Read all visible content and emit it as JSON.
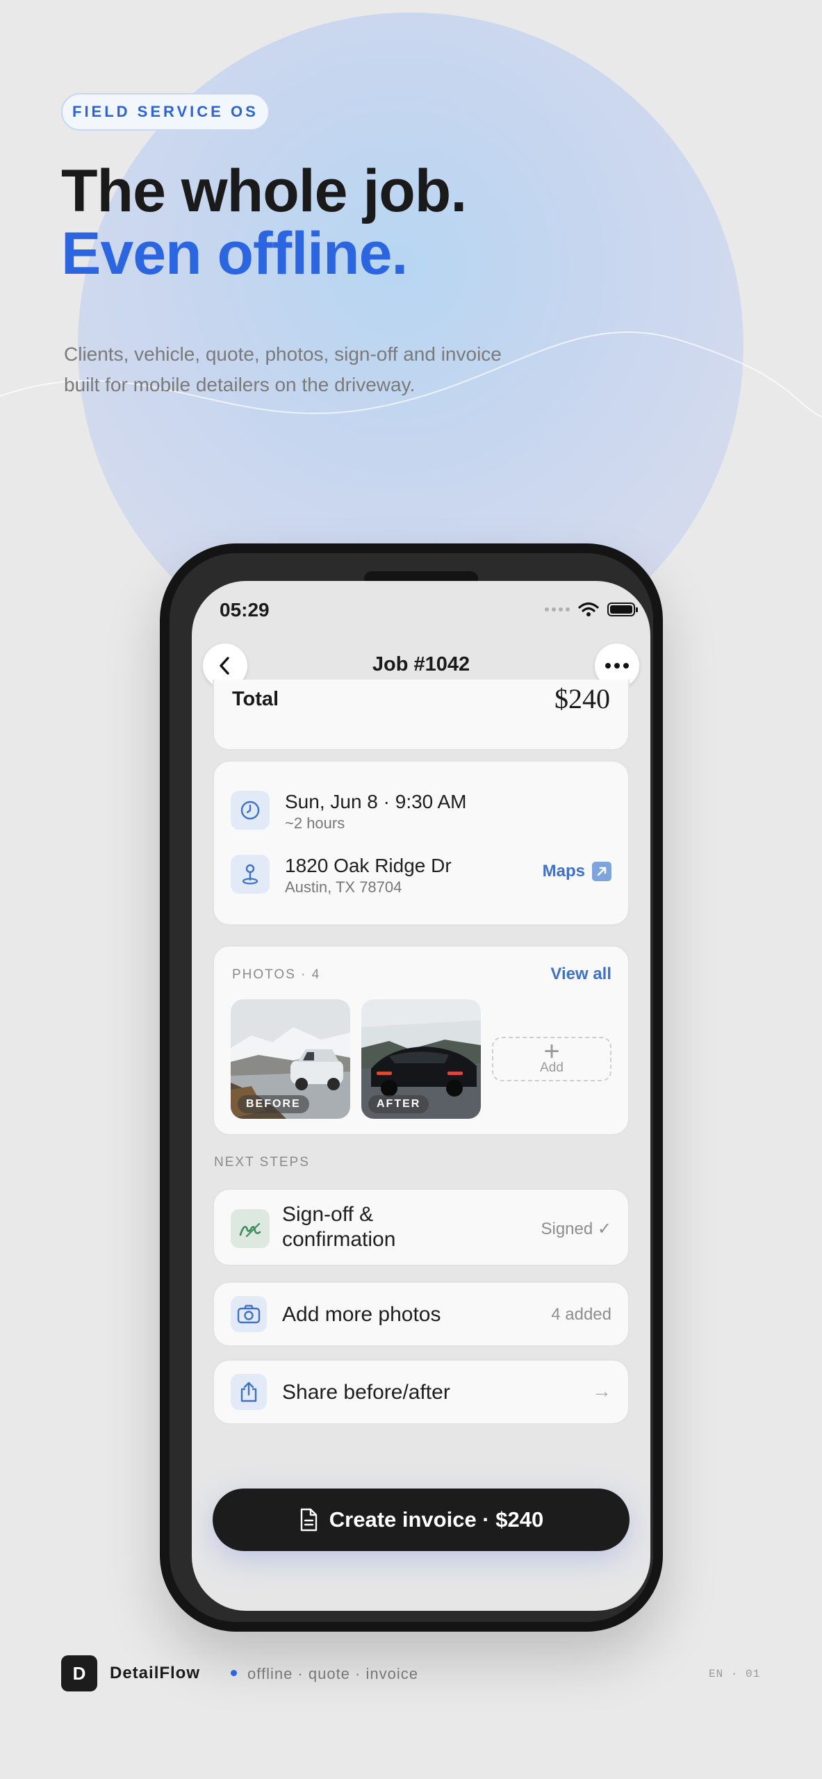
{
  "hero": {
    "badge": "FIELD SERVICE OS",
    "title_line1": "The whole job.",
    "title_line2": "Even offline.",
    "subtitle_line1": "Clients, vehicle, quote, photos, sign-off and invoice",
    "subtitle_line2": "built for mobile detailers on the driveway."
  },
  "status_bar": {
    "time": "05:29"
  },
  "nav": {
    "title": "Job #1042",
    "back_icon": "chevron-left-icon",
    "more_icon": "ellipsis-icon"
  },
  "total": {
    "label": "Total",
    "value": "$240"
  },
  "schedule": {
    "date": "Sun, Jun 8 · 9:30 AM",
    "duration": "~2 hours"
  },
  "location": {
    "street": "1820 Oak Ridge Dr",
    "city": "Austin, TX 78704",
    "maps_label": "Maps"
  },
  "photos": {
    "label": "PHOTOS · 4",
    "view_all": "View all",
    "items": [
      {
        "tag": "BEFORE"
      },
      {
        "tag": "AFTER"
      }
    ],
    "add_label": "Add"
  },
  "next_steps": {
    "label": "NEXT STEPS",
    "items": [
      {
        "label_line1": "Sign-off &",
        "label_line2": "confirmation",
        "meta": "Signed ✓",
        "icon": "signature-icon"
      },
      {
        "label": "Add more photos",
        "meta": "4 added",
        "icon": "camera-icon"
      },
      {
        "label": "Share before/after",
        "meta": "→",
        "icon": "share-icon"
      }
    ]
  },
  "cta": {
    "label": "Create invoice · $240",
    "icon": "document-icon"
  },
  "footer": {
    "logo_letter": "D",
    "brand": "DetailFlow",
    "tagline": "offline · quote · invoice",
    "locale": "EN · 01"
  },
  "colors": {
    "accent": "#2b66e0",
    "link": "#3f72c4",
    "dark": "#1c1c1c",
    "background": "#e9e9e9"
  }
}
